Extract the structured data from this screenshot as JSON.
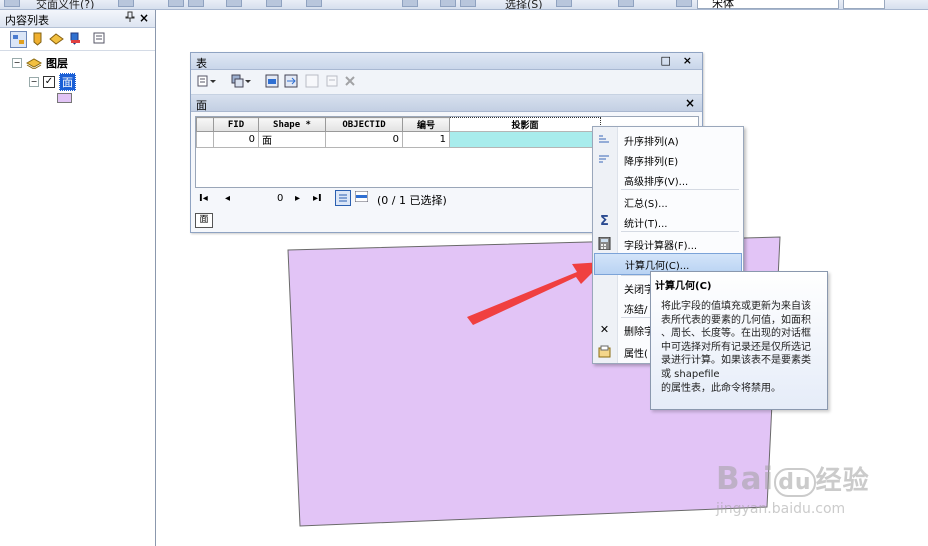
{
  "topbar": {
    "text_left": "交面义件(?)",
    "text_mid": "选择(S)",
    "combo_value": "宋体"
  },
  "toc": {
    "title": "内容列表",
    "pin_glyph": "ᵖ",
    "close_glyph": "×",
    "root_layer": "图层",
    "layer_name": "面",
    "checked_glyph": "✓",
    "expand_glyph": "⊟"
  },
  "table_window": {
    "title": "表",
    "title_buttons": "□ ×",
    "sub_title": "面",
    "sub_close": "×",
    "columns": [
      "FID",
      "Shape *",
      "OBJECTID",
      "编号",
      "投影面"
    ],
    "rows": [
      {
        "fid": "0",
        "shape": "面",
        "objectid": "0",
        "bianhao": "1",
        "touying": ""
      }
    ],
    "nav": {
      "first": "I◂",
      "prev": "◂",
      "record": "0",
      "next": "▸",
      "last": "▸I",
      "selection": "(0 / 1 已选择)"
    },
    "footer_tab": "面"
  },
  "context_menu": {
    "items": [
      {
        "label": "升序排列(A)",
        "icon": "sort-ascending-icon"
      },
      {
        "label": "降序排列(E)",
        "icon": "sort-descending-icon"
      },
      {
        "label": "高级排序(V)...",
        "icon": ""
      },
      {
        "label": "汇总(S)...",
        "icon": ""
      },
      {
        "label": "统计(T)...",
        "icon": "sigma-icon",
        "glyph": "Σ"
      },
      {
        "label": "字段计算器(F)...",
        "icon": "calculator-icon"
      },
      {
        "label": "计算几何(C)...",
        "icon": "",
        "highlighted": true
      },
      {
        "label": "关闭字",
        "icon": ""
      },
      {
        "label": "冻结/",
        "icon": ""
      },
      {
        "label": "删除字",
        "icon": "delete-icon",
        "glyph": "✕"
      },
      {
        "label": "属性(",
        "icon": "properties-icon"
      }
    ]
  },
  "tooltip": {
    "title": "计算几何(C)",
    "body": "将此字段的值填充或更新为来自该\n表所代表的要素的几何值，如面积\n、周长、长度等。在出现的对话框\n中可选择对所有记录还是仅所选记\n录进行计算。如果该表不是要素类\n或 shapefile\n的属性表，此命令将禁用。"
  },
  "watermark": {
    "brand": "Bai",
    "brand2": "du",
    "brand3": "经验",
    "url": "jingyan.baidu.com"
  },
  "colors": {
    "polygon_fill": "#e2c4f6",
    "polygon_stroke": "#6a6a6a",
    "arrow": "#f04040",
    "selected_cell": "#a8ecec",
    "menu_highlight": "#c4daf6"
  }
}
